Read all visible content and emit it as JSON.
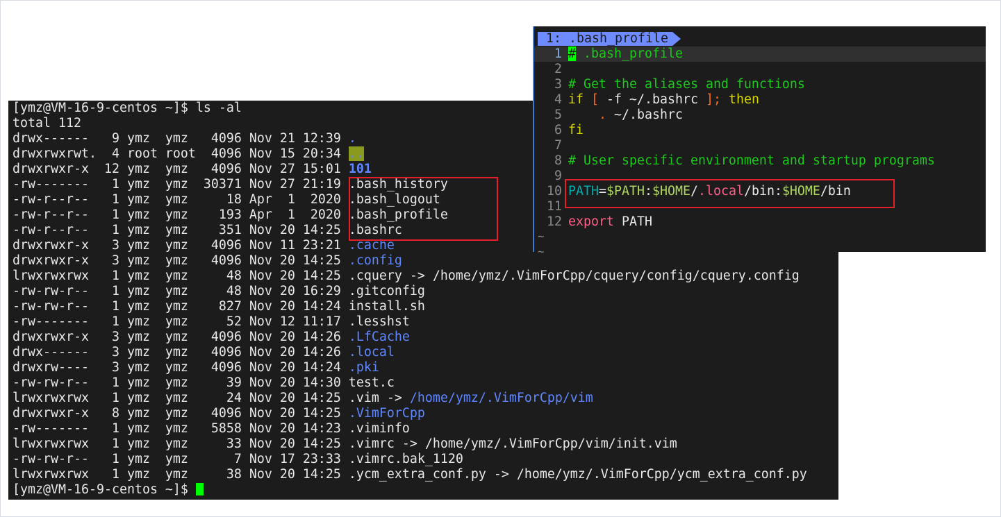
{
  "terminal": {
    "prompt": "[ymz@VM-16-9-centos ~]$ ",
    "command": "ls -al",
    "total": "total 112",
    "rows": [
      {
        "perm": "drwx------",
        "links": "9",
        "owner": "ymz",
        "group": "ymz",
        "size": "4096",
        "date": "Nov 21 12:39",
        "name": ".",
        "style": "blue"
      },
      {
        "perm": "drwxrwxrwt.",
        "links": "4",
        "owner": "root",
        "group": "root",
        "size": "4096",
        "date": "Nov 15 20:34",
        "name": "..",
        "style": "dotdot"
      },
      {
        "perm": "drwxrwxr-x",
        "links": "12",
        "owner": "ymz",
        "group": "ymz",
        "size": "4096",
        "date": "Nov 27 15:01",
        "name": "101",
        "style": "bblue"
      },
      {
        "perm": "-rw-------",
        "links": "1",
        "owner": "ymz",
        "group": "ymz",
        "size": "30371",
        "date": "Nov 27 21:19",
        "name": ".bash_history",
        "style": ""
      },
      {
        "perm": "-rw-r--r--",
        "links": "1",
        "owner": "ymz",
        "group": "ymz",
        "size": "18",
        "date": "Apr  1  2020",
        "name": ".bash_logout",
        "style": ""
      },
      {
        "perm": "-rw-r--r--",
        "links": "1",
        "owner": "ymz",
        "group": "ymz",
        "size": "193",
        "date": "Apr  1  2020",
        "name": ".bash_profile",
        "style": ""
      },
      {
        "perm": "-rw-r--r--",
        "links": "1",
        "owner": "ymz",
        "group": "ymz",
        "size": "351",
        "date": "Nov 20 14:25",
        "name": ".bashrc",
        "style": ""
      },
      {
        "perm": "drwxrwxr-x",
        "links": "3",
        "owner": "ymz",
        "group": "ymz",
        "size": "4096",
        "date": "Nov 11 23:21",
        "name": ".cache",
        "style": "blue"
      },
      {
        "perm": "drwxrwxr-x",
        "links": "3",
        "owner": "ymz",
        "group": "ymz",
        "size": "4096",
        "date": "Nov 20 14:25",
        "name": ".config",
        "style": "blue"
      },
      {
        "perm": "lrwxrwxrwx",
        "links": "1",
        "owner": "ymz",
        "group": "ymz",
        "size": "48",
        "date": "Nov 20 14:25",
        "name": ".cquery",
        "style": "",
        "target": "/home/ymz/.VimForCpp/cquery/config/cquery.config",
        "target_style": ""
      },
      {
        "perm": "-rw-rw-r--",
        "links": "1",
        "owner": "ymz",
        "group": "ymz",
        "size": "48",
        "date": "Nov 20 16:29",
        "name": ".gitconfig",
        "style": ""
      },
      {
        "perm": "-rw-rw-r--",
        "links": "1",
        "owner": "ymz",
        "group": "ymz",
        "size": "827",
        "date": "Nov 20 14:24",
        "name": "install.sh",
        "style": ""
      },
      {
        "perm": "-rw-------",
        "links": "1",
        "owner": "ymz",
        "group": "ymz",
        "size": "52",
        "date": "Nov 12 11:17",
        "name": ".lesshst",
        "style": ""
      },
      {
        "perm": "drwxrwxr-x",
        "links": "3",
        "owner": "ymz",
        "group": "ymz",
        "size": "4096",
        "date": "Nov 20 14:26",
        "name": ".LfCache",
        "style": "blue"
      },
      {
        "perm": "drwx------",
        "links": "3",
        "owner": "ymz",
        "group": "ymz",
        "size": "4096",
        "date": "Nov 20 14:26",
        "name": ".local",
        "style": "blue"
      },
      {
        "perm": "drwxrw----",
        "links": "3",
        "owner": "ymz",
        "group": "ymz",
        "size": "4096",
        "date": "Nov 20 14:24",
        "name": ".pki",
        "style": "blue"
      },
      {
        "perm": "-rw-rw-r--",
        "links": "1",
        "owner": "ymz",
        "group": "ymz",
        "size": "39",
        "date": "Nov 20 14:30",
        "name": "test.c",
        "style": ""
      },
      {
        "perm": "lrwxrwxrwx",
        "links": "1",
        "owner": "ymz",
        "group": "ymz",
        "size": "24",
        "date": "Nov 20 14:25",
        "name": ".vim",
        "style": "",
        "target": "/home/ymz/.VimForCpp/vim",
        "target_style": "blue"
      },
      {
        "perm": "drwxrwxr-x",
        "links": "8",
        "owner": "ymz",
        "group": "ymz",
        "size": "4096",
        "date": "Nov 20 14:25",
        "name": ".VimForCpp",
        "style": "blue"
      },
      {
        "perm": "-rw-------",
        "links": "1",
        "owner": "ymz",
        "group": "ymz",
        "size": "5858",
        "date": "Nov 20 14:23",
        "name": ".viminfo",
        "style": ""
      },
      {
        "perm": "lrwxrwxrwx",
        "links": "1",
        "owner": "ymz",
        "group": "ymz",
        "size": "33",
        "date": "Nov 20 14:25",
        "name": ".vimrc",
        "style": "",
        "target": "/home/ymz/.VimForCpp/vim/init.vim",
        "target_style": ""
      },
      {
        "perm": "-rw-rw-r--",
        "links": "1",
        "owner": "ymz",
        "group": "ymz",
        "size": "7",
        "date": "Nov 17 23:33",
        "name": ".vimrc.bak_1120",
        "style": ""
      },
      {
        "perm": "lrwxrwxrwx",
        "links": "1",
        "owner": "ymz",
        "group": "ymz",
        "size": "38",
        "date": "Nov 20 14:25",
        "name": ".ycm_extra_conf.py",
        "style": "",
        "target": "/home/ymz/.VimForCpp/ycm_extra_conf.py",
        "target_style": ""
      }
    ],
    "arrow": " -> "
  },
  "vim": {
    "tab_label": "1: .bash_profile",
    "lines": [
      {
        "n": "1",
        "segs": [
          [
            "#",
            "c-cur"
          ],
          [
            " .bash_profile",
            "c-com"
          ]
        ]
      },
      {
        "n": "2",
        "segs": []
      },
      {
        "n": "3",
        "segs": [
          [
            "# Get the aliases and functions",
            "c-com"
          ]
        ]
      },
      {
        "n": "4",
        "segs": [
          [
            "if",
            "c-kw"
          ],
          [
            " ",
            "c-txt"
          ],
          [
            "[",
            "c-br"
          ],
          [
            " -f ~/.bashrc ",
            "c-txt"
          ],
          [
            "];",
            "c-br"
          ],
          [
            " ",
            "c-txt"
          ],
          [
            "then",
            "c-kw"
          ]
        ]
      },
      {
        "n": "5",
        "segs": [
          [
            "    ",
            "c-txt"
          ],
          [
            ".",
            "c-br"
          ],
          [
            " ~/.bashrc",
            "c-txt"
          ]
        ]
      },
      {
        "n": "6",
        "segs": [
          [
            "fi",
            "c-kw"
          ]
        ]
      },
      {
        "n": "7",
        "segs": []
      },
      {
        "n": "8",
        "segs": [
          [
            "# User specific environment and startup programs",
            "c-com"
          ]
        ]
      },
      {
        "n": "9",
        "segs": []
      },
      {
        "n": "10",
        "segs": [
          [
            "PATH",
            "c-var"
          ],
          [
            "=",
            "c-txt"
          ],
          [
            "$PATH",
            "c-dol"
          ],
          [
            ":",
            "c-txt"
          ],
          [
            "$HOME",
            "c-dol"
          ],
          [
            "/",
            "c-txt"
          ],
          [
            ".local",
            "c-pink"
          ],
          [
            "/bin:",
            "c-txt"
          ],
          [
            "$HOME",
            "c-dol"
          ],
          [
            "/bin",
            "c-txt"
          ]
        ]
      },
      {
        "n": "11",
        "segs": []
      },
      {
        "n": "12",
        "segs": [
          [
            "export",
            "c-pink"
          ],
          [
            " PATH",
            "c-txt"
          ]
        ]
      }
    ],
    "tildes": [
      "~",
      "~"
    ]
  },
  "colors": {
    "directory": "#5f87ff",
    "comment": "#1ec81e",
    "highlight_box": "#e3202b",
    "cursor": "#00ff00"
  }
}
